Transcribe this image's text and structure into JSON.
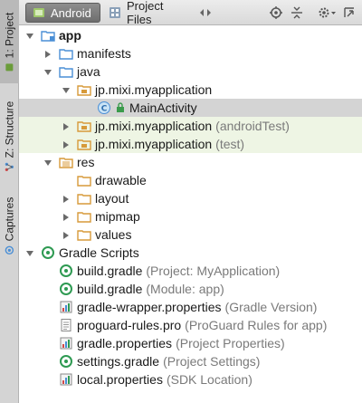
{
  "side_tabs": {
    "project": "1: Project",
    "structure": "Z: Structure",
    "captures": "Captures"
  },
  "toolbar": {
    "android_tab": "Android",
    "project_files_tab": "Project Files",
    "icons": [
      "switch-arrows-icon",
      "target-icon",
      "collapse-icon",
      "gear-icon",
      "hide-panel-icon"
    ]
  },
  "tree": {
    "app": "app",
    "manifests": "manifests",
    "java": "java",
    "pkg_main": "jp.mixi.myapplication",
    "main_activity": "MainActivity",
    "pkg_android_test": "jp.mixi.myapplication",
    "pkg_android_test_note": "(androidTest)",
    "pkg_test": "jp.mixi.myapplication",
    "pkg_test_note": "(test)",
    "res": "res",
    "drawable": "drawable",
    "layout": "layout",
    "mipmap": "mipmap",
    "values": "values",
    "gradle_scripts": "Gradle Scripts",
    "build_gradle_project": "build.gradle",
    "build_gradle_project_note": "(Project: MyApplication)",
    "build_gradle_module": "build.gradle",
    "build_gradle_module_note": "(Module: app)",
    "gradle_wrapper": "gradle-wrapper.properties",
    "gradle_wrapper_note": "(Gradle Version)",
    "proguard": "proguard-rules.pro",
    "proguard_note": "(ProGuard Rules for app)",
    "gradle_properties": "gradle.properties",
    "gradle_properties_note": "(Project Properties)",
    "settings_gradle": "settings.gradle",
    "settings_gradle_note": "(Project Settings)",
    "local_properties": "local.properties",
    "local_properties_note": "(SDK Location)"
  },
  "colors": {
    "folder_blue": "#4a8fd6",
    "folder_orange": "#d79a3a",
    "gradle_green": "#2e9a52",
    "selected_bg": "#d4d4d4",
    "test_bg": "#eef5e4",
    "muted_text": "#7a7a7a"
  }
}
